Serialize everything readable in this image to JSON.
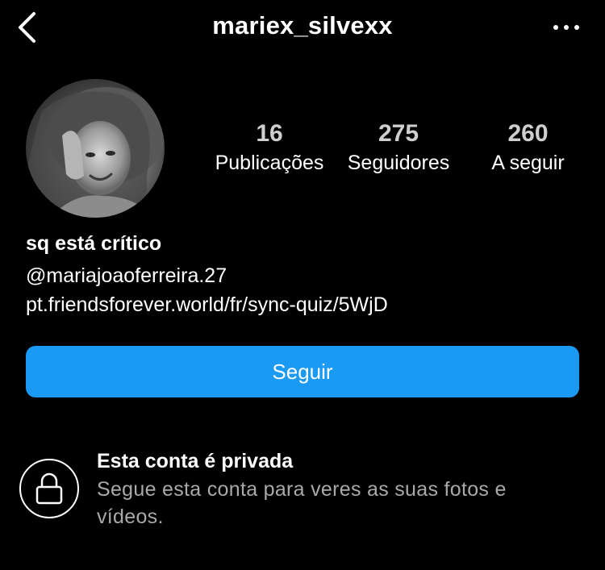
{
  "header": {
    "username": "mariex_silvexx",
    "back_icon": "chevron-left-icon",
    "more_icon": "more-horizontal-icon"
  },
  "stats": {
    "posts": {
      "count": "16",
      "label": "Publicações"
    },
    "followers": {
      "count": "275",
      "label": "Seguidores"
    },
    "following": {
      "count": "260",
      "label": "A seguir"
    }
  },
  "bio": {
    "name": "sq está crítico",
    "mention": "@mariajoaoferreira.27",
    "link": "pt.friendsforever.world/fr/sync-quiz/5WjD"
  },
  "follow_button": {
    "label": "Seguir",
    "color": "#1a9af2"
  },
  "private_notice": {
    "title": "Esta conta é privada",
    "description": "Segue esta conta para veres as suas fotos e vídeos.",
    "icon": "lock-icon"
  }
}
